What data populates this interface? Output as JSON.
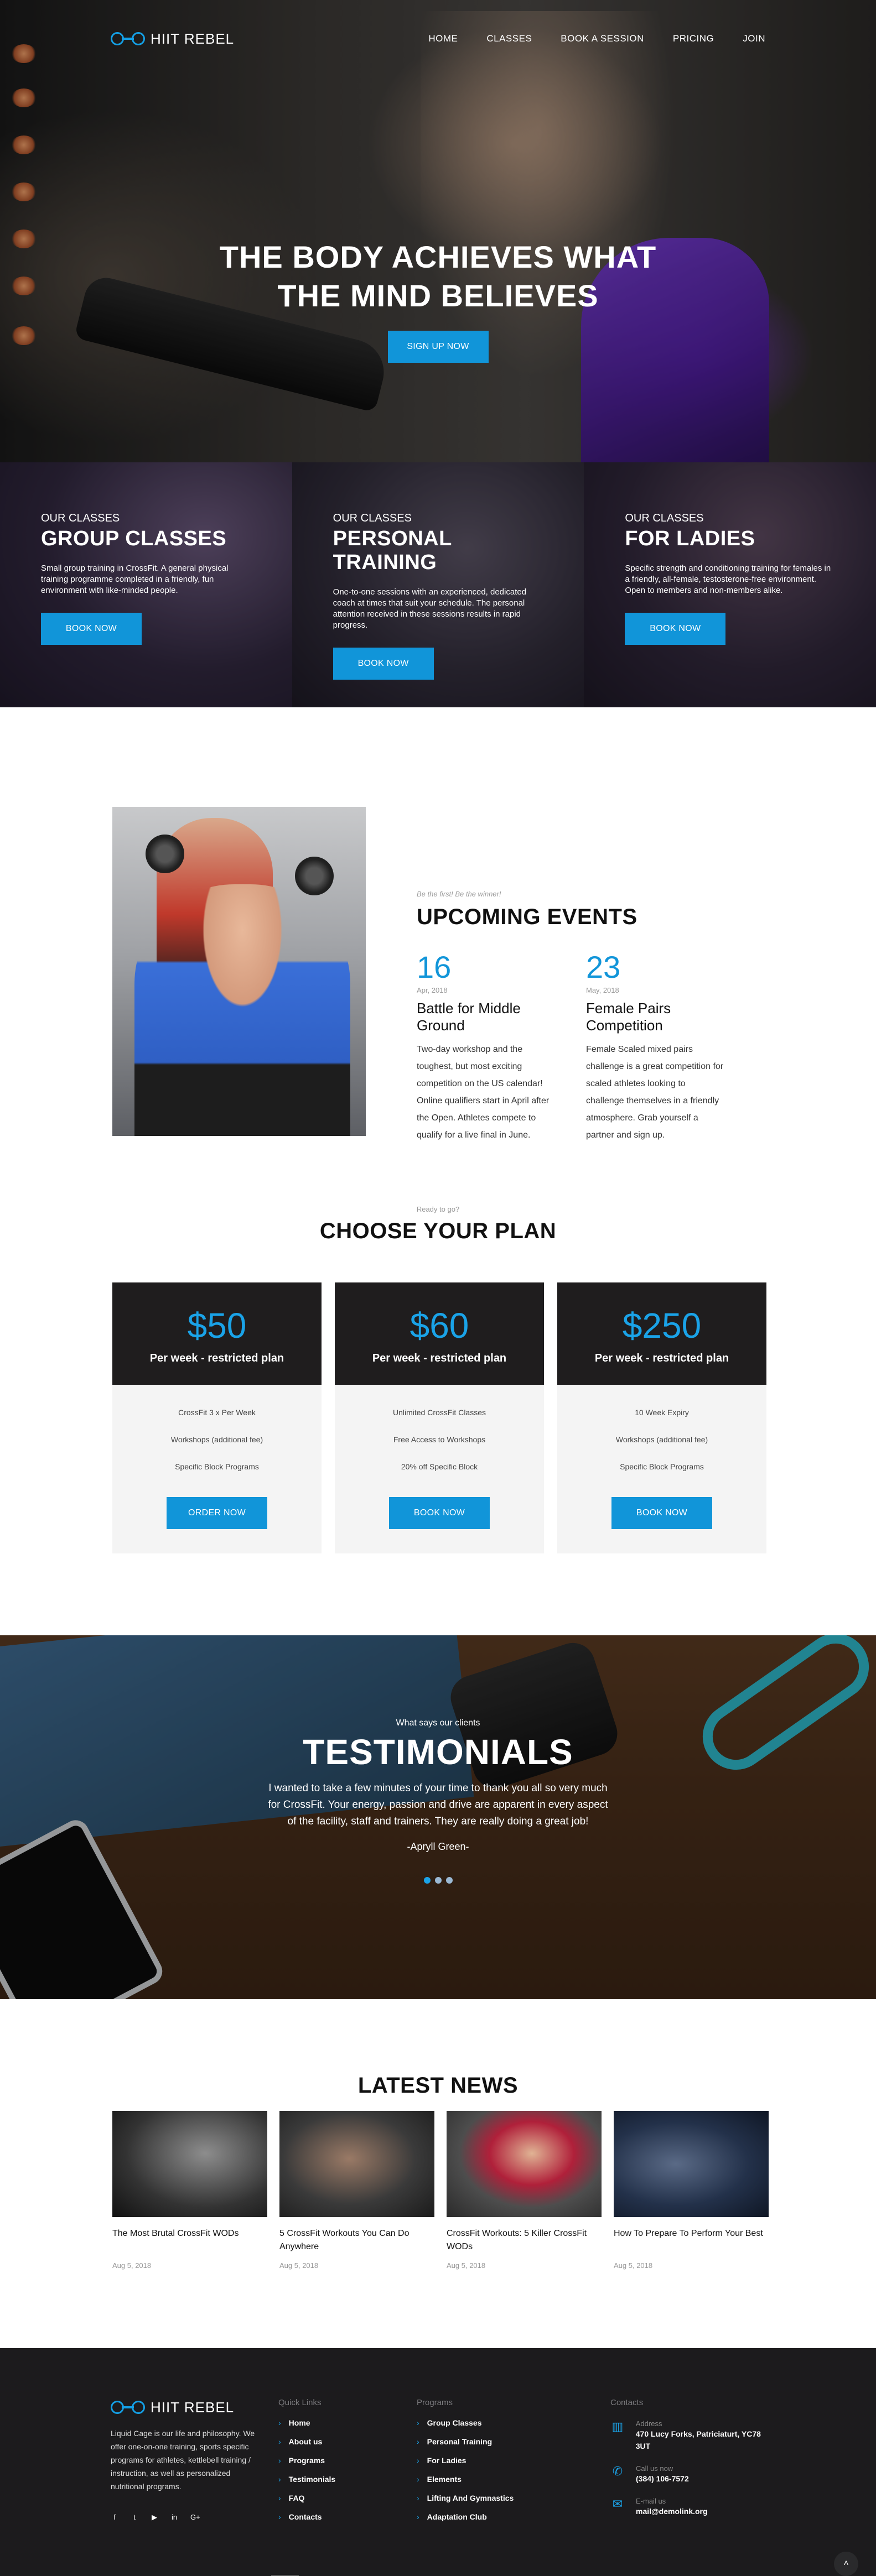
{
  "brand": {
    "name": "HIIT REBEL",
    "accent": "#1195d9"
  },
  "nav": {
    "items": [
      "HOME",
      "CLASSES",
      "BOOK A SESSION",
      "PRICING",
      "JOIN"
    ]
  },
  "hero": {
    "title_line1": "THE BODY ACHIEVES WHAT",
    "title_line2": "THE MIND BELIEVES",
    "cta": "SIGN UP NOW"
  },
  "classes": [
    {
      "eyebrow": "OUR CLASSES",
      "title": "GROUP CLASSES",
      "desc": "Small group training in CrossFit. A general physical training programme completed in a friendly, fun environment with like-minded people.",
      "cta": "BOOK NOW"
    },
    {
      "eyebrow": "OUR CLASSES",
      "title": "PERSONAL TRAINING",
      "desc": "One-to-one sessions with an experienced, dedicated coach at times that suit your schedule. The personal attention received in these sessions results in rapid progress.",
      "cta": "BOOK NOW"
    },
    {
      "eyebrow": "OUR CLASSES",
      "title": "FOR LADIES",
      "desc": "Specific strength and conditioning training for females in a friendly, all-female, testosterone-free environment. Open to members and non-members alike.",
      "cta": "BOOK NOW"
    }
  ],
  "events": {
    "eyebrow": "Be the first! Be the winner!",
    "title": "UPCOMING EVENTS",
    "items": [
      {
        "day": "16",
        "month": "Apr, 2018",
        "name": "Battle for Middle Ground",
        "desc": "Two-day workshop and the toughest, but most exciting competition on the US calendar! Online qualifiers start in April after the Open. Athletes compete to qualify for a live final in June."
      },
      {
        "day": "23",
        "month": "May, 2018",
        "name": "Female Pairs Competition",
        "desc": "Female Scaled mixed pairs challenge is a great competition for scaled athletes looking to challenge themselves in a friendly atmosphere. Grab yourself a partner and sign up."
      }
    ]
  },
  "plans": {
    "eyebrow": "Ready to go?",
    "title": "CHOOSE YOUR PLAN",
    "items": [
      {
        "price": "$50",
        "period": "Per week - restricted plan",
        "features": [
          "CrossFit 3 x Per Week",
          "Workshops (additional fee)",
          "Specific Block Programs"
        ],
        "cta": "ORDER NOW"
      },
      {
        "price": "$60",
        "period": "Per week - restricted plan",
        "features": [
          "Unlimited CrossFit Classes",
          "Free Access to Workshops",
          "20% off Specific Block"
        ],
        "cta": "BOOK NOW"
      },
      {
        "price": "$250",
        "period": "Per week - restricted plan",
        "features": [
          "10 Week Expiry",
          "Workshops (additional fee)",
          "Specific Block Programs"
        ],
        "cta": "BOOK NOW"
      }
    ]
  },
  "testimonials": {
    "eyebrow": "What says our clients",
    "title": "TESTIMONIALS",
    "quote": "I wanted to take a few minutes of your time to thank you all so very much for CrossFit.  Your energy, passion and drive are apparent in every aspect of the facility, staff and trainers. They are really doing a great job!",
    "author": "-Apryll Green-"
  },
  "news": {
    "title": "LATEST NEWS",
    "items": [
      {
        "title": "The Most Brutal CrossFit WODs",
        "date": "Aug 5, 2018"
      },
      {
        "title": "5 CrossFit Workouts You Can Do Anywhere",
        "date": "Aug 5, 2018"
      },
      {
        "title": "CrossFit Workouts: 5 Killer CrossFit WODs",
        "date": "Aug 5, 2018"
      },
      {
        "title": "How To Prepare To Perform Your Best",
        "date": "Aug 5, 2018"
      }
    ]
  },
  "footer": {
    "about": "Liquid Cage is our life and philosophy. We offer one-on-one training, sports specific programs for athletes, kettlebell training / instruction, as well as personalized nutritional programs.",
    "socials": [
      "f",
      "t",
      "▶",
      "in",
      "G+"
    ],
    "quick_links": {
      "heading": "Quick Links",
      "items": [
        "Home",
        "About us",
        "Programs",
        "Testimonials",
        "FAQ",
        "Contacts"
      ]
    },
    "programs": {
      "heading": "Programs",
      "items": [
        "Group Classes",
        "Personal Training",
        "For Ladies",
        "Elements",
        "Lifting And Gymnastics",
        "Adaptation Club"
      ]
    },
    "contacts": {
      "heading": "Contacts",
      "address_label": "Address",
      "address": "470 Lucy Forks, Patriciaturt, YC78 3UT",
      "phone_label": "Call us now",
      "phone": "(384) 106-7572",
      "email_label": "E-mail us",
      "email": "mail@demolink.org"
    }
  }
}
